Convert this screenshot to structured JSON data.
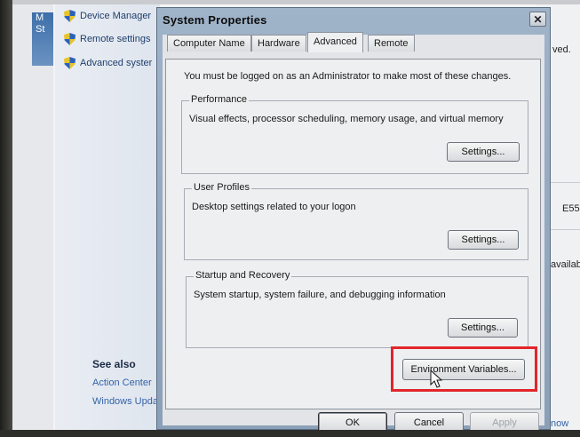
{
  "background_window": {
    "nav_items": [
      "Device Manager",
      "Remote settings",
      "Advanced syster"
    ],
    "see_also_heading": "See also",
    "see_also_links": [
      "Action Center",
      "Windows Update"
    ],
    "left_strip_text": [
      "M",
      "St"
    ],
    "right_fragments": [
      "ved.",
      "E55",
      "availab",
      "now"
    ]
  },
  "dialog": {
    "title": "System Properties",
    "close_label": "✕",
    "tabs": [
      "Computer Name",
      "Hardware",
      "Advanced",
      "Remote"
    ],
    "active_tab": "Advanced",
    "admin_note": "You must be logged on as an Administrator to make most of these changes.",
    "groups": [
      {
        "legend": "Performance",
        "description": "Visual effects, processor scheduling, memory usage, and virtual memory",
        "button": "Settings..."
      },
      {
        "legend": "User Profiles",
        "description": "Desktop settings related to your logon",
        "button": "Settings..."
      },
      {
        "legend": "Startup and Recovery",
        "description": "System startup, system failure, and debugging information",
        "button": "Settings..."
      }
    ],
    "env_vars_button": "Environment Variables...",
    "ok_button": "OK",
    "cancel_button": "Cancel",
    "apply_button": "Apply"
  },
  "colors": {
    "highlight": "#e2252b",
    "dialog_frame": "#9fb3c9"
  }
}
